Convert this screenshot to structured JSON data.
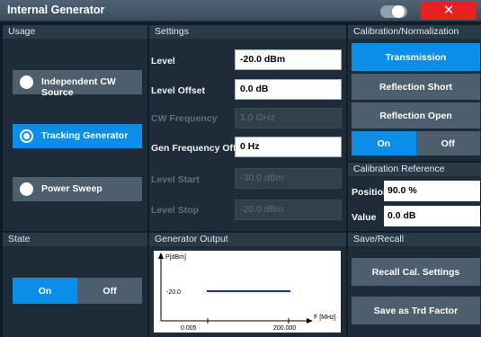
{
  "window": {
    "title": "Internal Generator",
    "close_glyph": "✕"
  },
  "usage": {
    "header": "Usage",
    "options": [
      {
        "label": "Independent CW Source",
        "selected": false
      },
      {
        "label": "Tracking Generator",
        "selected": true
      },
      {
        "label": "Power Sweep",
        "selected": false
      }
    ]
  },
  "settings": {
    "header": "Settings",
    "rows": [
      {
        "label": "Level",
        "value": "-20.0 dBm",
        "enabled": true
      },
      {
        "label": "Level Offset",
        "value": "0.0 dB",
        "enabled": true
      },
      {
        "label": "CW Frequency",
        "value": "1.0 GHz",
        "enabled": false
      },
      {
        "label": "Gen Frequency Offs",
        "value": "0 Hz",
        "enabled": true
      },
      {
        "label": "Level Start",
        "value": "-30.0 dBm",
        "enabled": false
      },
      {
        "label": "Level Stop",
        "value": "-20.0 dBm",
        "enabled": false
      }
    ]
  },
  "calibration": {
    "header": "Calibration/Normalization",
    "transmission": "Transmission",
    "reflection_short": "Reflection Short",
    "reflection_open": "Reflection Open",
    "on": "On",
    "off": "Off",
    "state": "On"
  },
  "cal_reference": {
    "header": "Calibration Reference",
    "position_label": "Position",
    "position_value": "90.0 %",
    "value_label": "Value",
    "value_value": "0.0 dB"
  },
  "state": {
    "header": "State",
    "on": "On",
    "off": "Off",
    "current": "On"
  },
  "generator_output": {
    "header": "Generator Output",
    "y_axis_label": "P[dBm]",
    "x_axis_label": "F [MHz]",
    "level_label": "-20.0",
    "x_start": "0.005",
    "x_stop": "200.000"
  },
  "save_recall": {
    "header": "Save/Recall",
    "recall": "Recall Cal. Settings",
    "save_trd": "Save as Trd Factor"
  },
  "colors": {
    "accent": "#0a8fe8",
    "close": "#e8211e",
    "trace": "#1a1aff"
  }
}
